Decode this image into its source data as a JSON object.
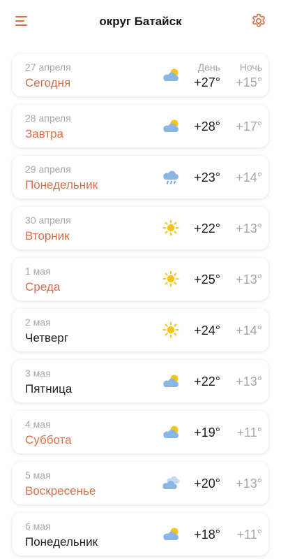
{
  "header": {
    "title": "округ Батайск"
  },
  "columns": {
    "day": "День",
    "night": "Ночь"
  },
  "days": [
    {
      "date": "27 апреля",
      "label": "Сегодня",
      "accent": true,
      "icon": "partly-cloudy-icon",
      "day_temp": "+27°",
      "night_temp": "+15°"
    },
    {
      "date": "28 апреля",
      "label": "Завтра",
      "accent": true,
      "icon": "partly-cloudy-icon",
      "day_temp": "+28°",
      "night_temp": "+17°"
    },
    {
      "date": "29 апреля",
      "label": "Понедельник",
      "accent": true,
      "icon": "rain-icon",
      "day_temp": "+23°",
      "night_temp": "+14°"
    },
    {
      "date": "30 апреля",
      "label": "Вторник",
      "accent": true,
      "icon": "sun-icon",
      "day_temp": "+22°",
      "night_temp": "+13°"
    },
    {
      "date": "1 мая",
      "label": "Среда",
      "accent": true,
      "icon": "sun-icon",
      "day_temp": "+25°",
      "night_temp": "+13°"
    },
    {
      "date": "2 мая",
      "label": "Четверг",
      "accent": false,
      "icon": "sun-icon",
      "day_temp": "+24°",
      "night_temp": "+14°"
    },
    {
      "date": "3 мая",
      "label": "Пятница",
      "accent": false,
      "icon": "partly-cloudy-icon",
      "day_temp": "+22°",
      "night_temp": "+13°"
    },
    {
      "date": "4 мая",
      "label": "Суббота",
      "accent": true,
      "icon": "partly-cloudy-icon",
      "day_temp": "+19°",
      "night_temp": "+11°"
    },
    {
      "date": "5 мая",
      "label": "Воскресенье",
      "accent": true,
      "icon": "cloudy-icon",
      "day_temp": "+20°",
      "night_temp": "+13°"
    },
    {
      "date": "6 мая",
      "label": "Понедельник",
      "accent": false,
      "icon": "partly-cloudy-icon",
      "day_temp": "+18°",
      "night_temp": "+11°"
    }
  ],
  "colors": {
    "accent": "#d9704a",
    "muted": "#a7a7a7",
    "text": "#1a1a1a",
    "sun": "#f8c417",
    "cloud": "#8ab6e4"
  }
}
